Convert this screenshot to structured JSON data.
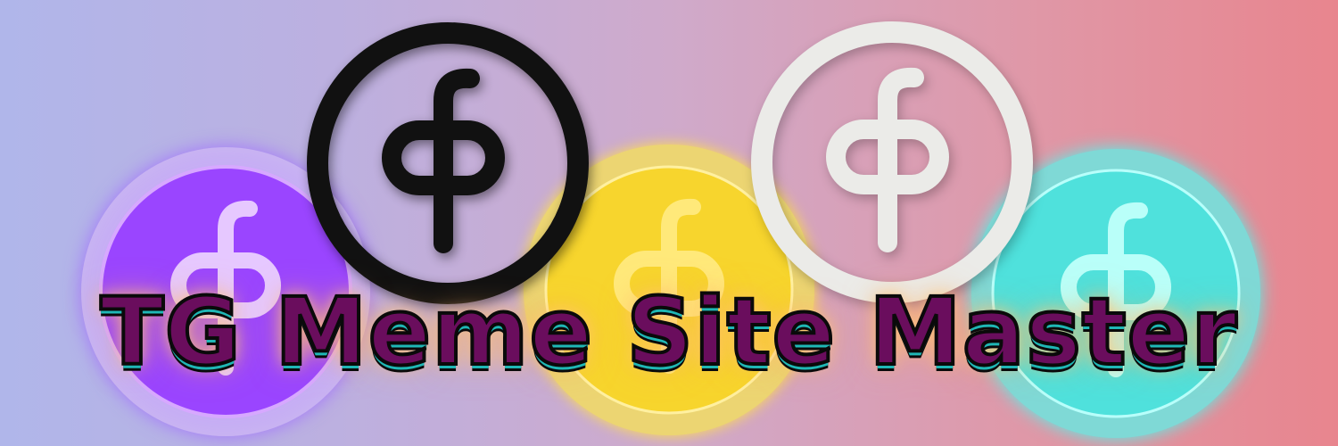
{
  "banner": {
    "title": "TG Meme Site Master"
  },
  "coins": [
    {
      "name": "purple-neon-coin",
      "color": "#9b4dff"
    },
    {
      "name": "black-ring-coin",
      "color": "#111111"
    },
    {
      "name": "gold-coin",
      "color": "#f4cf3a"
    },
    {
      "name": "white-ring-coin",
      "color": "#ebebe8"
    },
    {
      "name": "cyan-neon-coin",
      "color": "#5fe8e3"
    }
  ],
  "icons": {
    "coin_symbol": "phi-cross-symbol-icon"
  }
}
